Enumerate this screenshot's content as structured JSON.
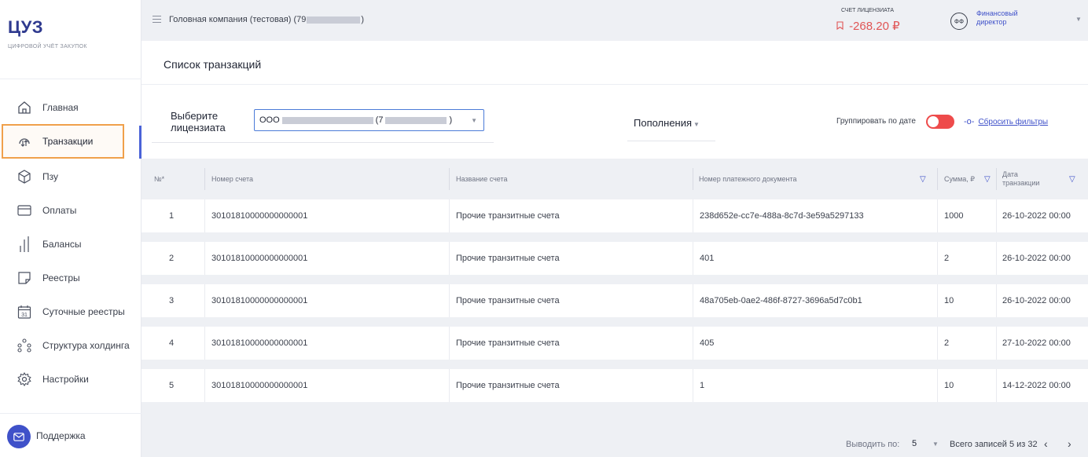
{
  "brand": {
    "logo": "ЦУЗ",
    "subtitle": "цифровой учёт закупок"
  },
  "sidebar": {
    "items": [
      {
        "label": "Главная",
        "icon": "home-icon"
      },
      {
        "label": "Транзакции",
        "icon": "transactions-icon",
        "active": true
      },
      {
        "label": "Пзу",
        "icon": "box-icon"
      },
      {
        "label": "Оплаты",
        "icon": "card-icon"
      },
      {
        "label": "Балансы",
        "icon": "bars-icon"
      },
      {
        "label": "Реестры",
        "icon": "document-icon"
      },
      {
        "label": "Суточные реестры",
        "icon": "calendar-icon",
        "badge": "31"
      },
      {
        "label": "Структура холдинга",
        "icon": "hierarchy-icon"
      },
      {
        "label": "Настройки",
        "icon": "gear-icon"
      }
    ],
    "support": "Поддержка"
  },
  "header": {
    "company_prefix": "Головная компания (тестовая) (79",
    "company_suffix": ")",
    "account_label": "СЧЕТ ЛИЦЕНЗИАТА",
    "account_value": "-268.20 ₽",
    "avatar_initials": "ФФ",
    "role": "Финансовый директор"
  },
  "page": {
    "title": "Список транзакций",
    "licensee_label": "Выберите лицензиата",
    "licensee_value_prefix": "ООО",
    "licensee_value_mid": "(7",
    "licensee_value_suffix": ")",
    "filter_type": "Пополнения",
    "group_by_date_label": "Группировать по дате",
    "group_by_date_on": true,
    "reset_filters": "Сбросить фильтры"
  },
  "table": {
    "columns": [
      "№*",
      "Номер счета",
      "Название счета",
      "Номер платежного документа",
      "Сумма, ₽",
      "Дата транзакции"
    ],
    "rows": [
      {
        "n": "1",
        "account": "30101810000000000001",
        "name": "Прочие транзитные счета",
        "doc": "238d652e-cc7e-488a-8c7d-3e59a5297133",
        "sum": "1000",
        "date": "26-10-2022 00:00"
      },
      {
        "n": "2",
        "account": "30101810000000000001",
        "name": "Прочие транзитные счета",
        "doc": "401",
        "sum": "2",
        "date": "26-10-2022 00:00"
      },
      {
        "n": "3",
        "account": "30101810000000000001",
        "name": "Прочие транзитные счета",
        "doc": "48a705eb-0ae2-486f-8727-3696a5d7c0b1",
        "sum": "10",
        "date": "26-10-2022 00:00"
      },
      {
        "n": "4",
        "account": "30101810000000000001",
        "name": "Прочие транзитные счета",
        "doc": "405",
        "sum": "2",
        "date": "27-10-2022 00:00"
      },
      {
        "n": "5",
        "account": "30101810000000000001",
        "name": "Прочие транзитные счета",
        "doc": "1",
        "sum": "10",
        "date": "14-12-2022 00:00"
      }
    ]
  },
  "pagination": {
    "per_page_label": "Выводить по:",
    "per_page": "5",
    "total": "Всего записей 5 из 32"
  },
  "colors": {
    "accent": "#3f51c9",
    "negative": "#e05555",
    "toggle": "#ee4b4b",
    "highlight": "#f0a04b"
  }
}
